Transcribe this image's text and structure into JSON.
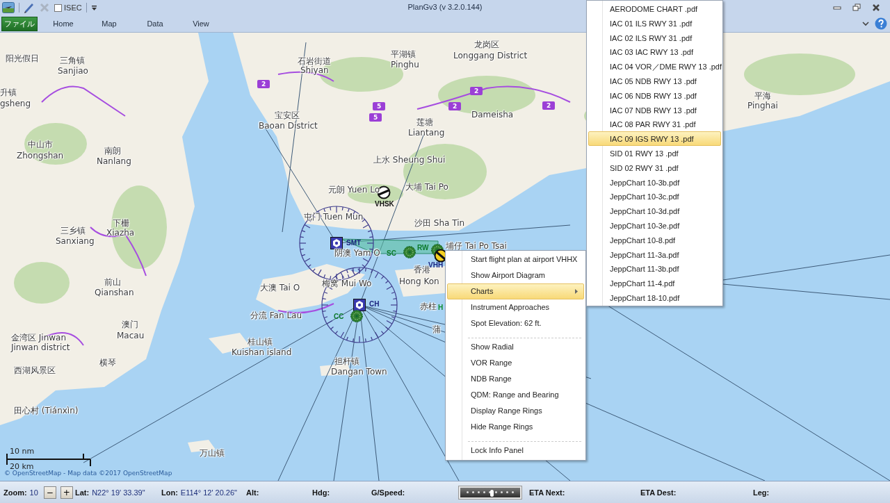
{
  "window": {
    "title": "PlanGv3 (v 3.2.0.144)"
  },
  "quick_access": {
    "isec": {
      "label": "ISEC",
      "checked": false
    }
  },
  "ribbon": {
    "tabs": [
      {
        "label": "ファイル",
        "kind": "file"
      },
      {
        "label": "Home",
        "kind": "tab"
      },
      {
        "label": "Map",
        "kind": "tab"
      },
      {
        "label": "Data",
        "kind": "tab"
      },
      {
        "label": "View",
        "kind": "tab"
      }
    ]
  },
  "map": {
    "place_labels": [
      "阳光假日",
      "三角镇",
      "Sanjiao",
      "升镇",
      "gsheng",
      "石岩街道",
      "Shiyan",
      "平湖镇",
      "Pinghu",
      "龙岗区",
      "Longgang District",
      "宝安区",
      "Baoan District",
      "莲塘",
      "Liantang",
      "Dameisha",
      "平海",
      "Pinghai",
      "中山市",
      "Zhongshan",
      "南朗",
      "Nanlang",
      "上水 Sheung Shui",
      "元朗 Yuen Lo",
      "大埔 Tai Po",
      "屯门 Tuen Mun",
      "沙田 Sha Tin",
      "埔仔 Tai Po Tsai",
      "三乡镇",
      "Sanxiang",
      "下栅",
      "Xiazha",
      "阴澳 Yam O",
      "香港",
      "前山",
      "大澳 Tai O",
      "梅窝 Mui Wo",
      "Hong Kon",
      "Qianshan",
      "赤柱",
      "澳门",
      "Macau",
      "金湾区 Jinwan",
      "Jinwan district",
      "分流 Fan Lau",
      "桂山镇",
      "Kuishan island",
      "横琴",
      "西湖风景区",
      "担杆镇",
      "Dangan Town",
      "田心村 (Tiánxìn)",
      "万山镇",
      "蒲"
    ],
    "road_shields": [
      "2",
      "5",
      "5",
      "2",
      "2",
      "2"
    ],
    "navaids": [
      {
        "label": "VHSK",
        "kind": "airport"
      },
      {
        "label": "SMT",
        "kind": "vor"
      },
      {
        "label": "SC",
        "kind": "ndb"
      },
      {
        "label": "RW",
        "kind": "ndb"
      },
      {
        "label": "VHH",
        "kind": "airport_major"
      },
      {
        "label": "CH",
        "kind": "vor"
      },
      {
        "label": "CC",
        "kind": "ndb"
      },
      {
        "label": "H",
        "kind": "fix"
      }
    ],
    "scale": {
      "nm": "10 nm",
      "km": "20 km"
    },
    "attribution": "© OpenStreetMap - Map data ©2017 OpenStreetMap"
  },
  "context_menu": {
    "items": [
      {
        "label": "Start flight plan at airport VHHX",
        "kind": "item",
        "selected": false
      },
      {
        "label": "Show Airport Diagram",
        "kind": "item",
        "selected": false
      },
      {
        "label": "Charts",
        "kind": "submenu",
        "selected": true
      },
      {
        "label": "Instrument Approaches",
        "kind": "item",
        "selected": false
      },
      {
        "label": "Spot Elevation: 62 ft.",
        "kind": "item",
        "selected": false
      },
      {
        "kind": "separator"
      },
      {
        "label": "Show Radial",
        "kind": "item",
        "selected": false
      },
      {
        "label": "VOR Range",
        "kind": "item",
        "selected": false
      },
      {
        "label": "NDB Range",
        "kind": "item",
        "selected": false
      },
      {
        "label": "QDM: Range and Bearing",
        "kind": "item",
        "selected": false
      },
      {
        "label": "Display Range Rings",
        "kind": "item",
        "selected": false
      },
      {
        "label": "Hide Range Rings",
        "kind": "item",
        "selected": false
      },
      {
        "kind": "separator"
      },
      {
        "label": "Lock Info Panel",
        "kind": "item",
        "selected": false
      }
    ]
  },
  "charts_submenu": {
    "items": [
      {
        "label": "AERODOME CHART .pdf",
        "selected": false
      },
      {
        "label": "IAC 01 ILS RWY 31 .pdf",
        "selected": false
      },
      {
        "label": "IAC 02 ILS RWY 31 .pdf",
        "selected": false
      },
      {
        "label": "IAC 03 IAC RWY 13 .pdf",
        "selected": false
      },
      {
        "label": "IAC 04 VOR／DME RWY 13 .pdf",
        "selected": false
      },
      {
        "label": "IAC 05 NDB RWY 13 .pdf",
        "selected": false
      },
      {
        "label": "IAC 06 NDB RWY 13 .pdf",
        "selected": false
      },
      {
        "label": "IAC 07 NDB RWY 13 .pdf",
        "selected": false
      },
      {
        "label": "IAC 08 PAR RWY 31 .pdf",
        "selected": false
      },
      {
        "label": "IAC 09 IGS RWY 13 .pdf",
        "selected": true
      },
      {
        "label": "SID 01 RWY 13 .pdf",
        "selected": false
      },
      {
        "label": "SID 02 RWY 31 .pdf",
        "selected": false
      },
      {
        "label": "JeppChart 10-3b.pdf",
        "selected": false
      },
      {
        "label": "JeppChart 10-3c.pdf",
        "selected": false
      },
      {
        "label": "JeppChart 10-3d.pdf",
        "selected": false
      },
      {
        "label": "JeppChart 10-3e.pdf",
        "selected": false
      },
      {
        "label": "JeppChart 10-8.pdf",
        "selected": false
      },
      {
        "label": "JeppChart 11-3a.pdf",
        "selected": false
      },
      {
        "label": "JeppChart 11-3b.pdf",
        "selected": false
      },
      {
        "label": "JeppChart 11-4.pdf",
        "selected": false
      },
      {
        "label": "JeppChart 18-10.pdf",
        "selected": false
      }
    ]
  },
  "status_bar": {
    "zoom": {
      "label": "Zoom:",
      "value": "10",
      "buttons": [
        "−",
        "+"
      ]
    },
    "fields": [
      {
        "label": "Lat:",
        "value": "N22° 19' 33.39\""
      },
      {
        "label": "Lon:",
        "value": "E114° 12' 20.26\""
      },
      {
        "label": "Alt:"
      },
      {
        "label": "Hdg:"
      },
      {
        "label": "G/Speed:"
      }
    ],
    "slider": {
      "level": 0.5
    },
    "fields_2": [
      {
        "label": "ETA Next:"
      },
      {
        "label": "ETA Dest:"
      },
      {
        "label": "Leg:"
      }
    ]
  }
}
